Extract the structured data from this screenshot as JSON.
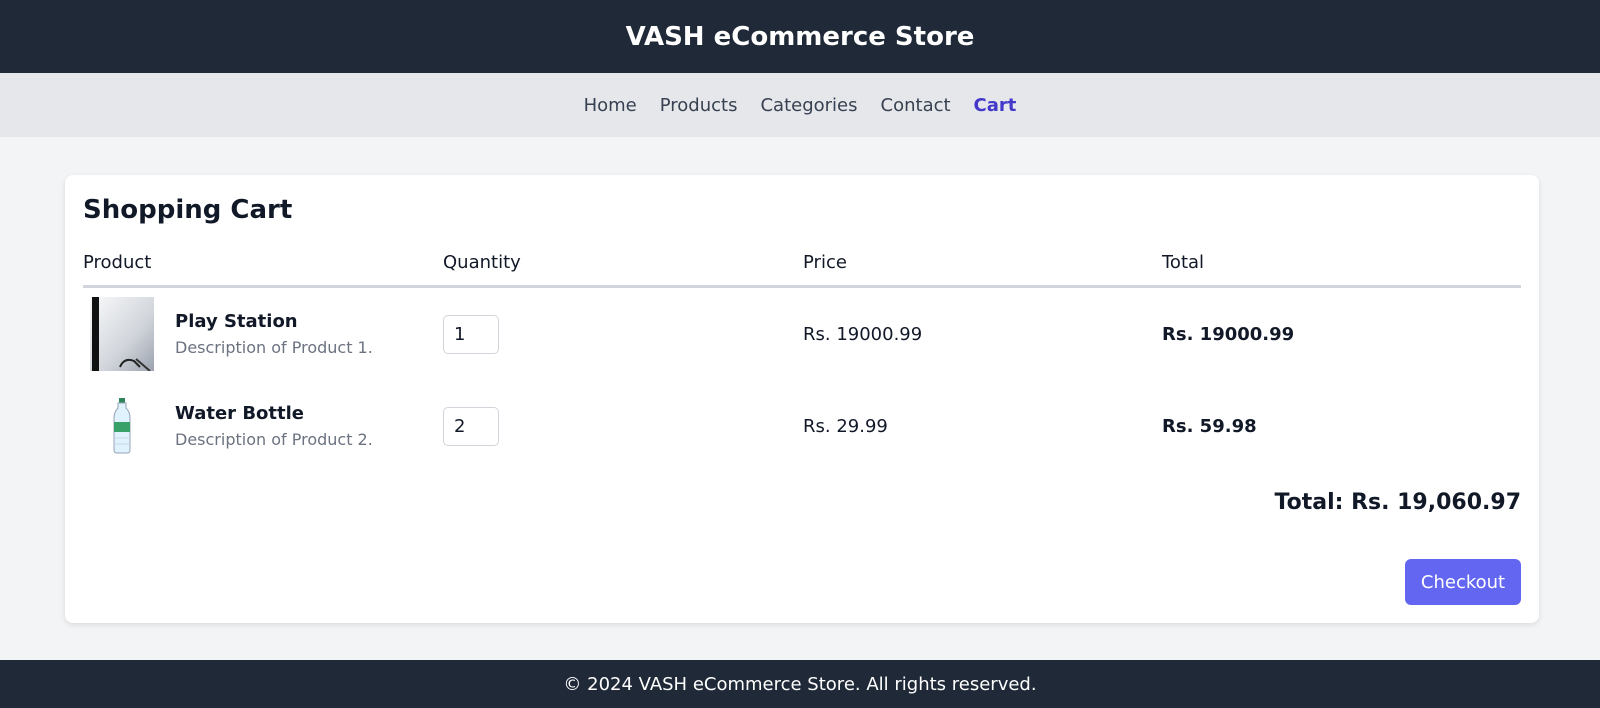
{
  "header": {
    "title": "VASH eCommerce Store"
  },
  "nav": {
    "items": [
      {
        "label": "Home"
      },
      {
        "label": "Products"
      },
      {
        "label": "Categories"
      },
      {
        "label": "Contact"
      },
      {
        "label": "Cart",
        "active": true
      }
    ]
  },
  "cart": {
    "title": "Shopping Cart",
    "columns": [
      "Product",
      "Quantity",
      "Price",
      "Total"
    ],
    "items": [
      {
        "name": "Play Station",
        "description": "Description of Product 1.",
        "quantity": "1",
        "price": "Rs. 19000.99",
        "total": "Rs. 19000.99",
        "image_icon": "playstation-image"
      },
      {
        "name": "Water Bottle",
        "description": "Description of Product 2.",
        "quantity": "2",
        "price": "Rs. 29.99",
        "total": "Rs. 59.98",
        "image_icon": "water-bottle-image"
      }
    ],
    "grand_total": "Total: Rs. 19,060.97",
    "checkout_label": "Checkout"
  },
  "footer": {
    "text": "© 2024 VASH eCommerce Store. All rights reserved."
  },
  "colors": {
    "header_bg": "#1f2937",
    "nav_bg": "#e5e7eb",
    "accent": "#6366f1",
    "active_link": "#4338ca"
  }
}
